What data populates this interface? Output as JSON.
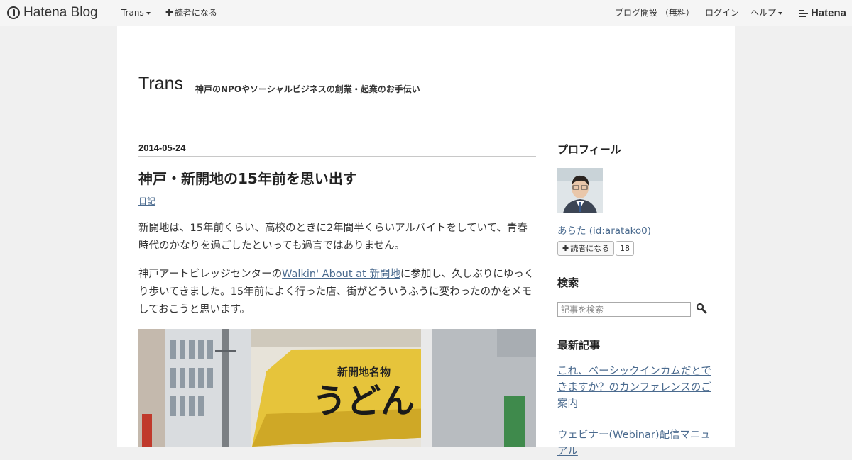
{
  "topbar": {
    "logo_text": "Hatena Blog",
    "menu_trans": "Trans",
    "menu_subscribe": "読者になる",
    "menu_open_blog": "ブログ開設 （無料）",
    "menu_login": "ログイン",
    "menu_help": "ヘルプ",
    "brand": "Hatena"
  },
  "blog": {
    "title": "Trans",
    "description": "神戸のNPOやソーシャルビジネスの創業・起業のお手伝い"
  },
  "entry": {
    "date": "2014-05-24",
    "title": "神戸・新開地の15年前を思い出す",
    "category": "日記",
    "para1": "新開地は、15年前くらい、高校のときに2年間半くらいアルバイトをしていて、青春時代のかなりを過ごしたといっても過言ではありません。",
    "para2_prefix": "神戸アートビレッジセンターの",
    "para2_link": "Walkin' About at 新開地",
    "para2_suffix": "に参加し、久しぶりにゆっくり歩いてきました。15年前によく行った店、街がどういうふうに変わったのかをメモしておこうと思います。",
    "photo_sign_top": "新開地名物",
    "photo_sign_main": "うどん"
  },
  "sidebar": {
    "profile_heading": "プロフィール",
    "profile_name": "あらた (id:aratako0)",
    "follow_label": "読者になる",
    "follow_count": "18",
    "search_heading": "検索",
    "search_placeholder": "記事を検索",
    "recent_heading": "最新記事",
    "recent": [
      "これ、ベーシックインカムだとできますか？のカンファレンスのご案内",
      "ウェビナー(Webinar)配信マニュアル"
    ]
  },
  "colors": {
    "link": "#4b6b8f",
    "page_bg": "#f0f0f0",
    "content_bg": "#ffffff"
  }
}
